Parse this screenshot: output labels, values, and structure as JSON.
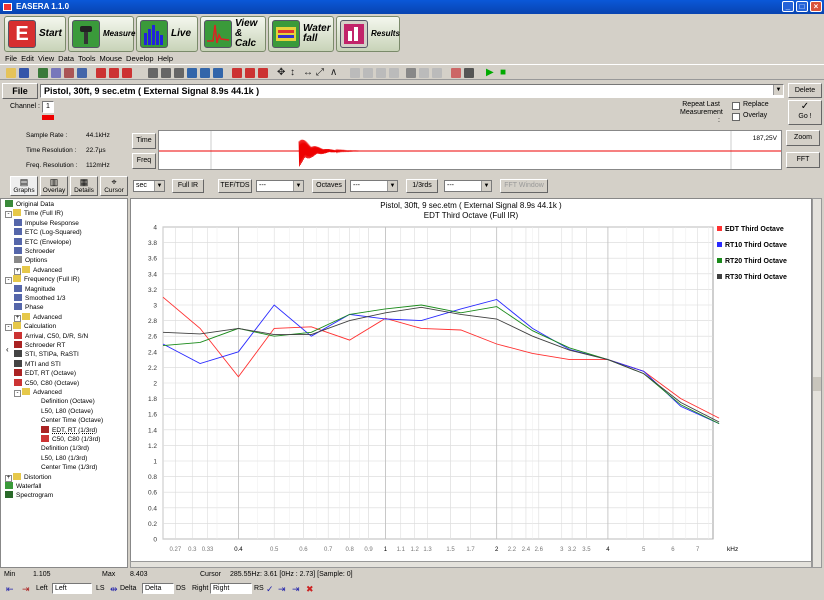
{
  "app": {
    "title": "EASERA 1.1.0"
  },
  "nav_tabs": [
    {
      "label": "Start",
      "icon": "easera-logo-icon"
    },
    {
      "label": "Measure",
      "icon": "microphone-icon"
    },
    {
      "label": "Live",
      "icon": "bar-meter-icon"
    },
    {
      "label_line1": "View",
      "label_line2": "& Calc",
      "icon": "impulse-view-icon"
    },
    {
      "label_line1": "Water",
      "label_line2": "fall",
      "icon": "waterfall-icon"
    },
    {
      "label": "Results",
      "icon": "results-icon"
    }
  ],
  "menu": [
    "File",
    "Edit",
    "View",
    "Data",
    "Tools",
    "Mouse",
    "Develop",
    "Help"
  ],
  "file_bar": {
    "file_label": "File",
    "file_name": "Pistol, 30ft, 9 sec.etm ( External Signal 8.9s 44.1k )",
    "delete_label": "Delete",
    "go_label": "Go !",
    "go_symbol": "✓"
  },
  "channel": {
    "label": "Channel :",
    "value": "1"
  },
  "repeat": {
    "label_line1": "Repeat Last",
    "label_line2": "Measurement :",
    "replace_label": "Replace",
    "overlay_label": "Overlay"
  },
  "info": {
    "sample_rate_label": "Sample Rate :",
    "sample_rate_value": "44.1kHz",
    "time_res_label": "Time Resolution :",
    "time_res_value": "22.7µs",
    "freq_res_label": "Freq. Resolution :",
    "freq_res_value": "112mHz"
  },
  "overview": {
    "time_label": "Time",
    "freq_label": "Freq",
    "value_readout": "187,25V",
    "zoom_label": "Zoom",
    "fft_label": "FFT"
  },
  "view_tabs": [
    "Graphs",
    "Overlay",
    "Details",
    "Cursor"
  ],
  "controls": {
    "unit_value": "sec",
    "full_ir_label": "Full IR",
    "tef_label": "TEF/TDS",
    "combo1_value": "---",
    "octaves_label": "Octaves",
    "combo2_value": "---",
    "third_label": "1/3rds",
    "combo3_value": "---",
    "fft_window_label": "FFT Window"
  },
  "tree": [
    {
      "label": "Original Data",
      "depth": 0,
      "icon": "data-icon"
    },
    {
      "label": "Time (Full IR)",
      "depth": 0,
      "icon": "folder-icon",
      "expander": "-"
    },
    {
      "label": "Impulse Response",
      "depth": 1,
      "icon": "graph-icon"
    },
    {
      "label": "ETC (Log-Squared)",
      "depth": 1,
      "icon": "graph-icon"
    },
    {
      "label": "ETC (Envelope)",
      "depth": 1,
      "icon": "graph-icon"
    },
    {
      "label": "Schroeder",
      "depth": 1,
      "icon": "graph-icon"
    },
    {
      "label": "Options",
      "depth": 1,
      "icon": "options-icon"
    },
    {
      "label": "Advanced",
      "depth": 1,
      "icon": "folder-icon",
      "expander": "+"
    },
    {
      "label": "Frequency (Full IR)",
      "depth": 0,
      "icon": "folder-icon",
      "expander": "-"
    },
    {
      "label": "Magnitude",
      "depth": 1,
      "icon": "graph-icon"
    },
    {
      "label": "Smoothed 1/3",
      "depth": 1,
      "icon": "graph-icon"
    },
    {
      "label": "Phase",
      "depth": 1,
      "icon": "graph-icon"
    },
    {
      "label": "Advanced",
      "depth": 1,
      "icon": "folder-icon",
      "expander": "+"
    },
    {
      "label": "Calculation",
      "depth": 0,
      "icon": "folder-icon",
      "expander": "-"
    },
    {
      "label": "Arrival, C50, D/R, S/N",
      "depth": 1,
      "icon": "c50-icon"
    },
    {
      "label": "Schroeder RT",
      "depth": 1,
      "icon": "rt-icon"
    },
    {
      "label": "STI, STIPa, RaSTI",
      "depth": 1,
      "icon": "sti-icon"
    },
    {
      "label": "MTI and STI",
      "depth": 1,
      "icon": "sti-icon"
    },
    {
      "label": "EDT, RT (Octave)",
      "depth": 1,
      "icon": "rt-icon"
    },
    {
      "label": "C50, C80 (Octave)",
      "depth": 1,
      "icon": "c50-icon"
    },
    {
      "label": "Advanced",
      "depth": 1,
      "icon": "folder-icon",
      "expander": "-"
    },
    {
      "label": "Definition (Octave)",
      "depth": 2,
      "icon": "none"
    },
    {
      "label": "L50, L80 (Octave)",
      "depth": 2,
      "icon": "none"
    },
    {
      "label": "Center Time (Octave)",
      "depth": 2,
      "icon": "none"
    },
    {
      "label": "EDT, RT (1/3rd)",
      "depth": 2,
      "icon": "rt-icon",
      "selected": true
    },
    {
      "label": "C50, C80 (1/3rd)",
      "depth": 2,
      "icon": "c50-icon"
    },
    {
      "label": "Definition (1/3rd)",
      "depth": 2,
      "icon": "none"
    },
    {
      "label": "L50, L80 (1/3rd)",
      "depth": 2,
      "icon": "none"
    },
    {
      "label": "Center Time (1/3rd)",
      "depth": 2,
      "icon": "none"
    },
    {
      "label": "Distortion",
      "depth": 0,
      "icon": "folder-icon",
      "expander": "+"
    },
    {
      "label": "Waterfall",
      "depth": 0,
      "icon": "waterfall-icon"
    },
    {
      "label": "Spectrogram",
      "depth": 0,
      "icon": "spectrogram-icon"
    }
  ],
  "chart_data": {
    "type": "line",
    "title": "Pistol, 30ft, 9 sec.etm ( External Signal 8.9s 44.1k )",
    "subtitle": "EDT Third Octave (Full IR)",
    "x_scale": "log",
    "xlabel": "kHz",
    "xlim": [
      0.25,
      7.7
    ],
    "ylim": [
      0,
      4
    ],
    "y_ticks": [
      "0",
      "0.2",
      "0.4",
      "0.6",
      "0.8",
      "1",
      "1.2",
      "1.4",
      "1.6",
      "1.8",
      "2",
      "2.2",
      "2.4",
      "2.6",
      "2.8",
      "3",
      "3.2",
      "3.4",
      "3.6",
      "3.8",
      "4"
    ],
    "x_tick_labels": [
      "0.27",
      "0.3",
      "0.33",
      "0.4",
      "0.5",
      "0.6",
      "0.7",
      "0.8",
      "0.9",
      "1",
      "1.1",
      "1.2",
      "1.3",
      "1.5",
      "1.7",
      "2",
      "2.2",
      "2.4",
      "2.6",
      "3",
      "3.2",
      "3.5",
      "4",
      "5",
      "6",
      "7"
    ],
    "x": [
      0.25,
      0.315,
      0.4,
      0.5,
      0.63,
      0.8,
      1.0,
      1.25,
      1.6,
      2.0,
      2.5,
      3.15,
      4.0,
      5.0,
      6.3,
      8.0
    ],
    "series": [
      {
        "name": "EDT Third Octave",
        "color": "#ff3030",
        "values": [
          3.1,
          2.7,
          2.08,
          2.7,
          2.72,
          2.55,
          2.83,
          2.7,
          2.68,
          2.5,
          2.38,
          2.3,
          2.3,
          2.15,
          1.8,
          1.55
        ]
      },
      {
        "name": "RT10 Third Octave",
        "color": "#2a2aff",
        "values": [
          2.5,
          2.25,
          2.4,
          3.0,
          2.6,
          2.88,
          2.82,
          2.8,
          2.95,
          3.07,
          2.7,
          2.43,
          2.3,
          2.15,
          1.7,
          1.48
        ]
      },
      {
        "name": "RT20 Third Octave",
        "color": "#1a8a1a",
        "values": [
          2.48,
          2.52,
          2.7,
          2.6,
          2.65,
          2.88,
          2.95,
          3.0,
          2.9,
          2.98,
          2.67,
          2.45,
          2.3,
          2.12,
          1.72,
          1.48
        ]
      },
      {
        "name": "RT30 Third Octave",
        "color": "#404040",
        "values": [
          2.65,
          2.63,
          2.7,
          2.62,
          2.62,
          2.8,
          2.9,
          2.97,
          2.88,
          2.82,
          2.6,
          2.42,
          2.3,
          2.12,
          1.75,
          1.5
        ]
      }
    ],
    "legend": "right",
    "grid": true
  },
  "status": {
    "min_label": "Min",
    "min_value": "1.105",
    "max_label": "Max",
    "max_value": "8.403",
    "cursor_label": "Cursor",
    "cursor_value": "285.55Hz: 3.61  [0Hz : 2.73] [Sample: 0]"
  },
  "bottom": {
    "left_label": "Left",
    "left_value": "Left",
    "ls_label": "LS",
    "delta_label": "Delta",
    "delta_value": "Delta",
    "ds_label": "DS",
    "right_label": "Right",
    "right_value": "Right",
    "rs_label": "RS"
  }
}
